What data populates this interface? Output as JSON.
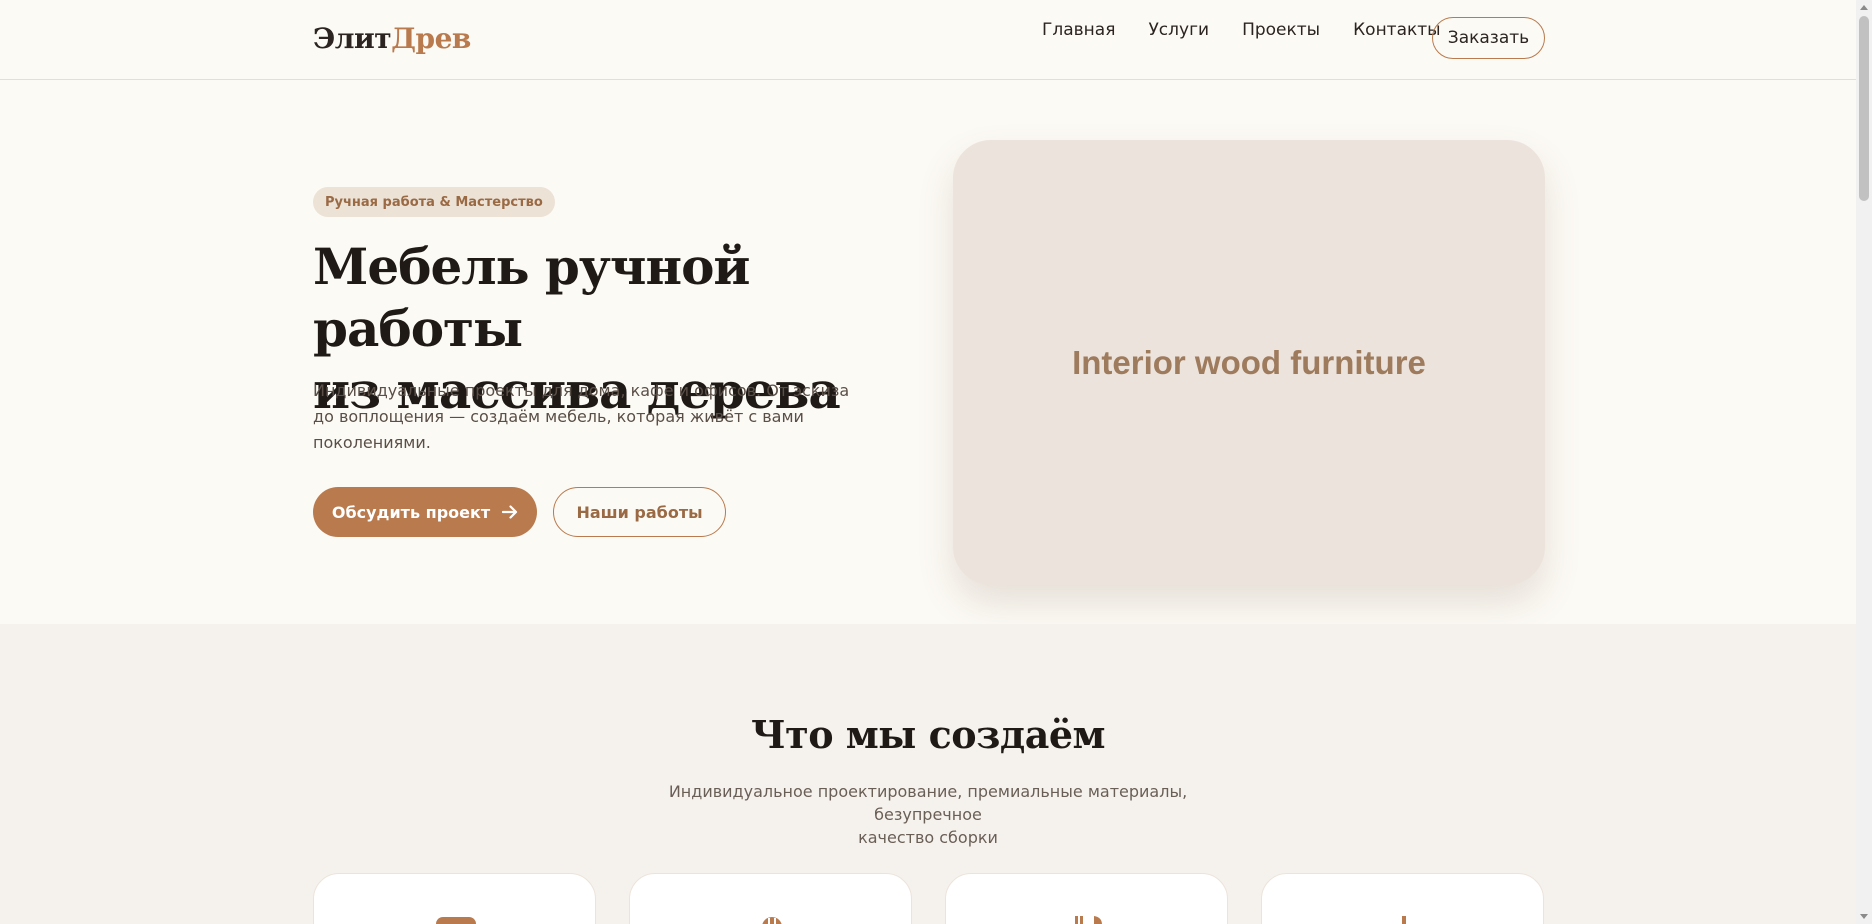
{
  "header": {
    "logo_part1": "Элит",
    "logo_part2": "Древ",
    "nav": [
      {
        "label": "Главная"
      },
      {
        "label": "Услуги"
      },
      {
        "label": "Проекты"
      },
      {
        "label": "Контакты"
      }
    ],
    "order_label": "Заказать"
  },
  "hero": {
    "badge": "Ручная работа & Мастерство",
    "title_lines": [
      "Мебель ручной работы",
      "из массива дерева"
    ],
    "text_lines": [
      "Индивидуальные проекты для дома, кафе и офисов. От эскиза",
      "до воплощения — создаём мебель, которая живёт с вами",
      "поколениями."
    ],
    "primary_button": "Обсудить проект",
    "primary_button_icon": "arrow-right-icon",
    "secondary_button": "Наши работы",
    "image_placeholder": "Interior wood furniture"
  },
  "services": {
    "title": "Что мы создаём",
    "subtitle_lines": [
      "Индивидуальное проектирование, премиальные материалы, безупречное",
      "качество сборки"
    ],
    "cards": [
      {
        "icon": "sofa-icon"
      },
      {
        "icon": "cafe-icon"
      },
      {
        "icon": "utensils-icon"
      },
      {
        "icon": "lamp-icon"
      }
    ]
  },
  "colors": {
    "accent": "#b97a4e",
    "background": "#fcfaf5",
    "section_background": "#f5f1ec",
    "text_dark": "#1f1a16",
    "badge_background": "#ece2d6",
    "image_background": "#ece3dd"
  }
}
